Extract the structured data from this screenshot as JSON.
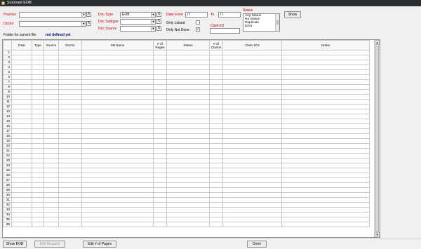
{
  "window": {
    "title": "Scanned EOB"
  },
  "filters": {
    "practice_label": "Practice",
    "practice_value": "",
    "doctor_label": "Doctor",
    "doctor_value": "",
    "doc_type_label": "Doc Type",
    "doc_type_value": "EOB",
    "doc_subtype_label": "Doc Subtype",
    "doc_subtype_value": "",
    "doc_source_label": "Doc Source",
    "doc_source_value": "",
    "date_from_label": "Date From",
    "date_from_value": " / /",
    "to_label": "To",
    "to_value": " / /",
    "only_linked_label": "Only Linked",
    "only_linked_checked": "",
    "only_not_done_label": "Only Not Done",
    "only_not_done_checked": "✓",
    "claim_id_label": "Claim ID",
    "claim_id_value": "",
    "status_label": "Status",
    "status_options": [
      "Any Status",
      "No Status",
      "Duplicate",
      "Error"
    ],
    "show_button": "Show",
    "clear_glyph": "X",
    "dropdown_glyph": "▼"
  },
  "folder": {
    "label": "Folder for current file",
    "value": "not defined yet"
  },
  "grid": {
    "columns": [
      "",
      "Date",
      "Type",
      "Source",
      "Doctor",
      "SB Name",
      "# of Pages",
      "Status",
      "# of Claims",
      "Claim ID's",
      "Notes"
    ],
    "row_numbers": [
      "1",
      "2",
      "3",
      "4",
      "5",
      "6",
      "7",
      "8",
      "9",
      "10",
      "11",
      "12",
      "13",
      "14",
      "15",
      "16",
      "17",
      "18",
      "19",
      "20",
      "21",
      "22",
      "23",
      "24",
      "25",
      "26",
      "27",
      "28",
      "29",
      "30",
      "31",
      "32",
      "33",
      "34",
      "35",
      "36"
    ]
  },
  "bottom_buttons": {
    "show_eob": "Show EOB",
    "edit_request": "Edit Request",
    "edit_pages": "Edit # of Pages",
    "done": "Done"
  }
}
